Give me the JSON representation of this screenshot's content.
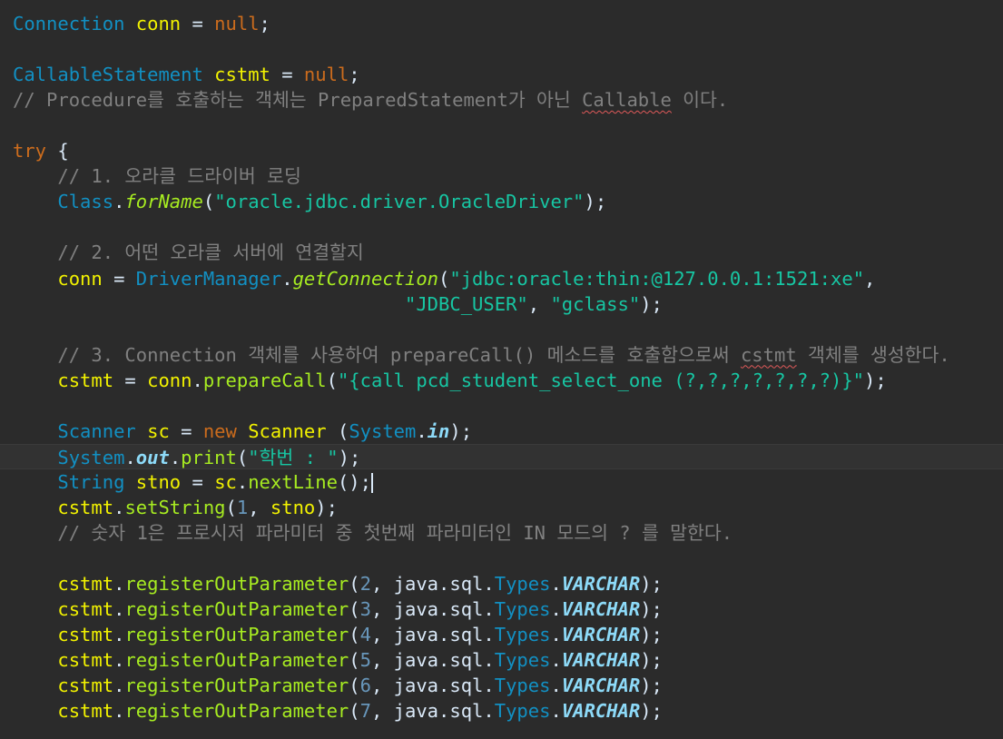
{
  "colors": {
    "background": "#2b2b2b",
    "type": "#1290c3",
    "variable": "#f2f200",
    "keyword": "#cc6c1d",
    "string": "#17c6a3",
    "comment": "#808080",
    "method": "#a7ec21",
    "field": "#8ddaf8",
    "plain": "#d9e8f7"
  },
  "code_lines": [
    [
      {
        "k": "type",
        "t": "Connection"
      },
      {
        "k": "plain",
        "t": " "
      },
      {
        "k": "var",
        "t": "conn"
      },
      {
        "k": "plain",
        "t": " = "
      },
      {
        "k": "kw",
        "t": "null"
      },
      {
        "k": "plain",
        "t": ";"
      }
    ],
    [],
    [
      {
        "k": "type",
        "t": "CallableStatement"
      },
      {
        "k": "plain",
        "t": " "
      },
      {
        "k": "var",
        "t": "cstmt"
      },
      {
        "k": "plain",
        "t": " = "
      },
      {
        "k": "kw",
        "t": "null"
      },
      {
        "k": "plain",
        "t": ";"
      }
    ],
    [
      {
        "k": "comment",
        "t": "// Procedure를 호출하는 객체는 PreparedStatement가 아닌 "
      },
      {
        "k": "comment-warn",
        "t": "Callable"
      },
      {
        "k": "comment",
        "t": " 이다."
      }
    ],
    [],
    [
      {
        "k": "kw",
        "t": "try"
      },
      {
        "k": "plain",
        "t": " {"
      }
    ],
    [
      {
        "k": "plain",
        "t": "    "
      },
      {
        "k": "comment",
        "t": "// 1. 오라클 드라이버 로딩"
      }
    ],
    [
      {
        "k": "plain",
        "t": "    "
      },
      {
        "k": "type",
        "t": "Class"
      },
      {
        "k": "plain",
        "t": "."
      },
      {
        "k": "method",
        "t": "forName"
      },
      {
        "k": "plain",
        "t": "("
      },
      {
        "k": "str",
        "t": "\"oracle.jdbc.driver.OracleDriver\""
      },
      {
        "k": "plain",
        "t": ");"
      }
    ],
    [],
    [
      {
        "k": "plain",
        "t": "    "
      },
      {
        "k": "comment",
        "t": "// 2. 어떤 오라클 서버에 연결할지"
      }
    ],
    [
      {
        "k": "plain",
        "t": "    "
      },
      {
        "k": "var",
        "t": "conn"
      },
      {
        "k": "plain",
        "t": " = "
      },
      {
        "k": "type",
        "t": "DriverManager"
      },
      {
        "k": "plain",
        "t": "."
      },
      {
        "k": "method",
        "t": "getConnection"
      },
      {
        "k": "plain",
        "t": "("
      },
      {
        "k": "str",
        "t": "\"jdbc:oracle:thin:@127.0.0.1:1521:xe\""
      },
      {
        "k": "plain",
        "t": ","
      }
    ],
    [
      {
        "k": "plain",
        "t": "                                   "
      },
      {
        "k": "str",
        "t": "\"JDBC_USER\""
      },
      {
        "k": "plain",
        "t": ", "
      },
      {
        "k": "str",
        "t": "\"gclass\""
      },
      {
        "k": "plain",
        "t": ");"
      }
    ],
    [],
    [
      {
        "k": "plain",
        "t": "    "
      },
      {
        "k": "comment",
        "t": "// 3. Connection 객체를 사용하여 prepareCall() 메소드를 호출함으로써 "
      },
      {
        "k": "comment-warn",
        "t": "cstmt"
      },
      {
        "k": "comment",
        "t": " 객체를 생성한다."
      }
    ],
    [
      {
        "k": "plain",
        "t": "    "
      },
      {
        "k": "var",
        "t": "cstmt"
      },
      {
        "k": "plain",
        "t": " = "
      },
      {
        "k": "var",
        "t": "conn"
      },
      {
        "k": "plain",
        "t": "."
      },
      {
        "k": "call",
        "t": "prepareCall"
      },
      {
        "k": "plain",
        "t": "("
      },
      {
        "k": "str",
        "t": "\"{call pcd_student_select_one (?,?,?,?,?,?,?)}\""
      },
      {
        "k": "plain",
        "t": ");"
      }
    ],
    [],
    [
      {
        "k": "plain",
        "t": "    "
      },
      {
        "k": "type",
        "t": "Scanner"
      },
      {
        "k": "plain",
        "t": " "
      },
      {
        "k": "var",
        "t": "sc"
      },
      {
        "k": "plain",
        "t": " = "
      },
      {
        "k": "kw",
        "t": "new"
      },
      {
        "k": "plain",
        "t": " "
      },
      {
        "k": "var",
        "t": "Scanner"
      },
      {
        "k": "plain",
        "t": " ("
      },
      {
        "k": "type",
        "t": "System"
      },
      {
        "k": "plain",
        "t": "."
      },
      {
        "k": "field",
        "t": "in"
      },
      {
        "k": "plain",
        "t": ");"
      }
    ],
    [
      {
        "k": "plain",
        "t": "    "
      },
      {
        "k": "type",
        "t": "System"
      },
      {
        "k": "plain",
        "t": "."
      },
      {
        "k": "field",
        "t": "out"
      },
      {
        "k": "plain",
        "t": "."
      },
      {
        "k": "call",
        "t": "print"
      },
      {
        "k": "plain",
        "t": "("
      },
      {
        "k": "str",
        "t": "\"학번 : \""
      },
      {
        "k": "plain",
        "t": ");"
      }
    ],
    [
      {
        "k": "plain",
        "t": "    "
      },
      {
        "k": "type",
        "t": "String"
      },
      {
        "k": "plain",
        "t": " "
      },
      {
        "k": "var",
        "t": "stno"
      },
      {
        "k": "plain",
        "t": " = "
      },
      {
        "k": "var",
        "t": "sc"
      },
      {
        "k": "plain",
        "t": "."
      },
      {
        "k": "call",
        "t": "nextLine"
      },
      {
        "k": "plain",
        "t": "();"
      },
      {
        "k": "caret",
        "t": ""
      }
    ],
    [
      {
        "k": "plain",
        "t": "    "
      },
      {
        "k": "var",
        "t": "cstmt"
      },
      {
        "k": "plain",
        "t": "."
      },
      {
        "k": "call",
        "t": "setString"
      },
      {
        "k": "plain",
        "t": "("
      },
      {
        "k": "num",
        "t": "1"
      },
      {
        "k": "plain",
        "t": ", "
      },
      {
        "k": "var",
        "t": "stno"
      },
      {
        "k": "plain",
        "t": ");"
      }
    ],
    [
      {
        "k": "plain",
        "t": "    "
      },
      {
        "k": "comment",
        "t": "// 숫자 1은 프로시저 파라미터 중 첫번째 파라미터인 IN 모드의 ? 를 말한다."
      }
    ],
    [],
    [
      {
        "k": "plain",
        "t": "    "
      },
      {
        "k": "var",
        "t": "cstmt"
      },
      {
        "k": "plain",
        "t": "."
      },
      {
        "k": "call",
        "t": "registerOutParameter"
      },
      {
        "k": "plain",
        "t": "("
      },
      {
        "k": "num",
        "t": "2"
      },
      {
        "k": "plain",
        "t": ", "
      },
      {
        "k": "plain",
        "t": "java.sql."
      },
      {
        "k": "type",
        "t": "Types"
      },
      {
        "k": "plain",
        "t": "."
      },
      {
        "k": "const",
        "t": "VARCHAR"
      },
      {
        "k": "plain",
        "t": ");"
      }
    ],
    [
      {
        "k": "plain",
        "t": "    "
      },
      {
        "k": "var",
        "t": "cstmt"
      },
      {
        "k": "plain",
        "t": "."
      },
      {
        "k": "call",
        "t": "registerOutParameter"
      },
      {
        "k": "plain",
        "t": "("
      },
      {
        "k": "num",
        "t": "3"
      },
      {
        "k": "plain",
        "t": ", "
      },
      {
        "k": "plain",
        "t": "java.sql."
      },
      {
        "k": "type",
        "t": "Types"
      },
      {
        "k": "plain",
        "t": "."
      },
      {
        "k": "const",
        "t": "VARCHAR"
      },
      {
        "k": "plain",
        "t": ");"
      }
    ],
    [
      {
        "k": "plain",
        "t": "    "
      },
      {
        "k": "var",
        "t": "cstmt"
      },
      {
        "k": "plain",
        "t": "."
      },
      {
        "k": "call",
        "t": "registerOutParameter"
      },
      {
        "k": "plain",
        "t": "("
      },
      {
        "k": "num",
        "t": "4"
      },
      {
        "k": "plain",
        "t": ", "
      },
      {
        "k": "plain",
        "t": "java.sql."
      },
      {
        "k": "type",
        "t": "Types"
      },
      {
        "k": "plain",
        "t": "."
      },
      {
        "k": "const",
        "t": "VARCHAR"
      },
      {
        "k": "plain",
        "t": ");"
      }
    ],
    [
      {
        "k": "plain",
        "t": "    "
      },
      {
        "k": "var",
        "t": "cstmt"
      },
      {
        "k": "plain",
        "t": "."
      },
      {
        "k": "call",
        "t": "registerOutParameter"
      },
      {
        "k": "plain",
        "t": "("
      },
      {
        "k": "num",
        "t": "5"
      },
      {
        "k": "plain",
        "t": ", "
      },
      {
        "k": "plain",
        "t": "java.sql."
      },
      {
        "k": "type",
        "t": "Types"
      },
      {
        "k": "plain",
        "t": "."
      },
      {
        "k": "const",
        "t": "VARCHAR"
      },
      {
        "k": "plain",
        "t": ");"
      }
    ],
    [
      {
        "k": "plain",
        "t": "    "
      },
      {
        "k": "var",
        "t": "cstmt"
      },
      {
        "k": "plain",
        "t": "."
      },
      {
        "k": "call",
        "t": "registerOutParameter"
      },
      {
        "k": "plain",
        "t": "("
      },
      {
        "k": "num",
        "t": "6"
      },
      {
        "k": "plain",
        "t": ", "
      },
      {
        "k": "plain",
        "t": "java.sql."
      },
      {
        "k": "type",
        "t": "Types"
      },
      {
        "k": "plain",
        "t": "."
      },
      {
        "k": "const",
        "t": "VARCHAR"
      },
      {
        "k": "plain",
        "t": ");"
      }
    ],
    [
      {
        "k": "plain",
        "t": "    "
      },
      {
        "k": "var",
        "t": "cstmt"
      },
      {
        "k": "plain",
        "t": "."
      },
      {
        "k": "call",
        "t": "registerOutParameter"
      },
      {
        "k": "plain",
        "t": "("
      },
      {
        "k": "num",
        "t": "7"
      },
      {
        "k": "plain",
        "t": ", "
      },
      {
        "k": "plain",
        "t": "java.sql."
      },
      {
        "k": "type",
        "t": "Types"
      },
      {
        "k": "plain",
        "t": "."
      },
      {
        "k": "const",
        "t": "VARCHAR"
      },
      {
        "k": "plain",
        "t": ");"
      }
    ]
  ],
  "current_line": 18
}
